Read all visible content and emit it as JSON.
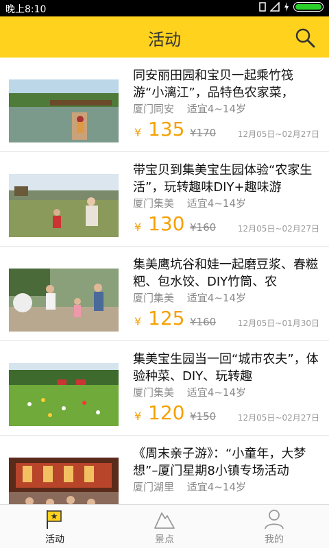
{
  "status_bar": {
    "time": "晚上8:10"
  },
  "header": {
    "title": "活动"
  },
  "activities": [
    {
      "title": "同安丽田园和宝贝一起乘竹筏游“小漓江”，品特色农家菜，",
      "location": "厦门同安",
      "age": "适宜4~14岁",
      "currency": "¥",
      "price": "135",
      "old_price": "¥170",
      "dates": "12月05日~02月27日"
    },
    {
      "title": "带宝贝到集美宝生园体验“农家生活”，玩转趣味DIY+趣味游",
      "location": "厦门集美",
      "age": "适宜4~14岁",
      "currency": "¥",
      "price": "130",
      "old_price": "¥160",
      "dates": "12月05日~02月27日"
    },
    {
      "title": "集美鹰坑谷和娃一起磨豆浆、春糍粑、包水饺、DIY竹筒、农",
      "location": "厦门集美",
      "age": "适宜4~14岁",
      "currency": "¥",
      "price": "125",
      "old_price": "¥160",
      "dates": "12月05日~01月30日"
    },
    {
      "title": "集美宝生园当一回“城市农夫”，体验种菜、DIY、玩转趣",
      "location": "厦门集美",
      "age": "适宜4~14岁",
      "currency": "¥",
      "price": "120",
      "old_price": "¥150",
      "dates": "12月05日~02月27日"
    },
    {
      "title": "《周末亲子游》：“小童年，大梦想”–厦门星期8小镇专场活动",
      "location": "厦门湖里",
      "age": "适宜4~14岁",
      "currency": "¥",
      "price": "",
      "old_price": "",
      "dates": ""
    }
  ],
  "tabbar": {
    "tabs": [
      {
        "label": "活动",
        "icon": "flag-icon",
        "active": true
      },
      {
        "label": "景点",
        "icon": "mountain-icon",
        "active": false
      },
      {
        "label": "我的",
        "icon": "person-icon",
        "active": false
      }
    ]
  },
  "colors": {
    "brand": "#ffd21e",
    "price": "#f5a000",
    "battery": "#2bd12b"
  }
}
